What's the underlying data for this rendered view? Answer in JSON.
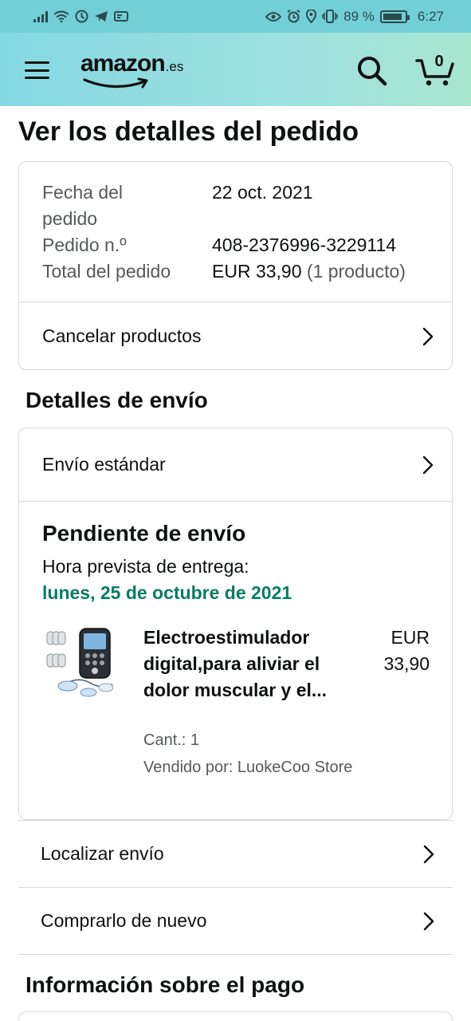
{
  "status_bar": {
    "battery_percent": "89 %",
    "time": "6:27",
    "battery_level": 0.89
  },
  "header": {
    "logo_text": "amazon",
    "logo_tld": ".es",
    "cart_count": "0"
  },
  "page": {
    "title": "Ver los detalles del pedido"
  },
  "order_summary": {
    "date_label_line1": "Fecha del",
    "date_label_line2": "pedido",
    "date_value": "22 oct. 2021",
    "order_number_label": "Pedido n.º",
    "order_number_value": "408-2376996-3229114",
    "total_label": "Total del pedido",
    "total_value": "EUR 33,90",
    "total_items": "(1 producto)",
    "cancel_label": "Cancelar productos"
  },
  "shipping": {
    "section_title": "Detalles de envío",
    "method_label": "Envío estándar",
    "status_title": "Pendiente de envío",
    "delivery_label": "Hora prevista de entrega:",
    "delivery_date": "lunes, 25 de octubre de 2021",
    "product": {
      "name": "Electroestimulador digital,para aliviar el dolor muscular y el...",
      "price_currency": "EUR",
      "price_value": "33,90",
      "quantity": "Cant.: 1",
      "seller": "Vendido por: LuokeCoo Store"
    },
    "track_label": "Localizar envío",
    "buy_again_label": "Comprarlo de nuevo"
  },
  "payment": {
    "section_title": "Información sobre el pago"
  },
  "colors": {
    "header_start": "#84d8e2",
    "header_end": "#a8e6cf",
    "status_bar": "#72cfd6",
    "delivery_green": "#067d62",
    "muted_text": "#565959",
    "border": "#d5d9d9"
  }
}
